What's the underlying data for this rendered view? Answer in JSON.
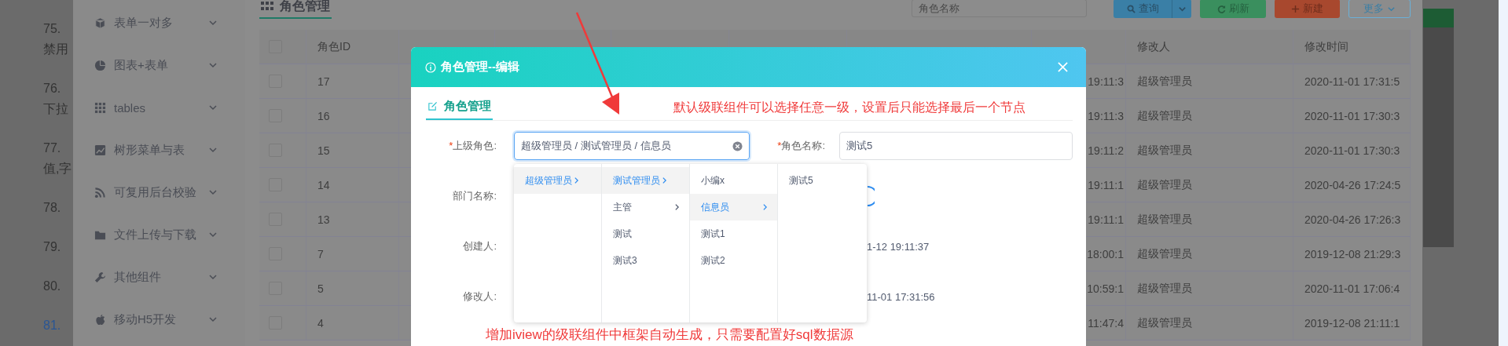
{
  "doc_items": [
    {
      "number": "75.",
      "lines": [
        "禁用"
      ],
      "active": false
    },
    {
      "number": "76.",
      "lines": [
        "下拉"
      ],
      "active": false
    },
    {
      "number": "77.",
      "lines": [
        "值,字"
      ],
      "active": false
    },
    {
      "number": "78.",
      "active": false
    },
    {
      "number": "79.",
      "active": false
    },
    {
      "number": "80.",
      "active": false
    },
    {
      "number": "81.",
      "active": true
    }
  ],
  "sidebar": {
    "items": [
      {
        "label": "表单一对多",
        "kind": "cube"
      },
      {
        "label": "图表+表单",
        "kind": "pie"
      },
      {
        "label": "tables",
        "kind": "grid"
      },
      {
        "label": "树形菜单与表",
        "kind": "chart"
      },
      {
        "label": "可复用后台校验",
        "kind": "rss"
      },
      {
        "label": "文件上传与下载",
        "kind": "folder"
      },
      {
        "label": "其他组件",
        "kind": "wrench"
      },
      {
        "label": "移动H5开发",
        "kind": "fruit"
      }
    ]
  },
  "page_title": "角色管理",
  "search": {
    "placeholder": "角色名称"
  },
  "buttons": [
    {
      "label": "查询",
      "kind": "query"
    },
    {
      "label": "刷新",
      "kind": "refresh"
    },
    {
      "label": "新建",
      "kind": "create"
    },
    {
      "label": "更多",
      "kind": "more"
    }
  ],
  "table": {
    "header_checked": false,
    "columns": [
      {
        "label": "角色ID"
      },
      {},
      {},
      {},
      {},
      {},
      {},
      {
        "label": "修改人"
      },
      {
        "label": "修改时间"
      }
    ],
    "rows": [
      {
        "checked": false,
        "id": "17",
        "column_8": "19:11:3",
        "modified_by": "超级管理员",
        "modified_time": "2020-11-01 17:31:5"
      },
      {
        "checked": false,
        "id": "16",
        "column_8": "19:11:3",
        "modified_by": "超级管理员",
        "modified_time": "2020-11-01 17:30:3"
      },
      {
        "checked": false,
        "id": "15",
        "column_8": "19:11:2",
        "modified_by": "超级管理员",
        "modified_time": "2020-11-01 17:30:3"
      },
      {
        "checked": false,
        "id": "14",
        "column_8": "19:11:1",
        "modified_by": "超级管理员",
        "modified_time": "2020-04-26 17:24:5"
      },
      {
        "checked": false,
        "id": "13",
        "column_8": "19:11:1",
        "modified_by": "超级管理员",
        "modified_time": "2020-04-26 17:26:3"
      },
      {
        "checked": false,
        "id": "7",
        "column_8": "18:00:1",
        "modified_by": "超级管理员",
        "modified_time": "2019-12-08 21:29:3"
      },
      {
        "checked": false,
        "id": "5",
        "column_8": "10:59:1",
        "modified_by": "超级管理员",
        "modified_time": "2020-11-01 17:06:4"
      },
      {
        "checked": false,
        "id": "4",
        "column_8": "11:47:4",
        "modified_by": "超级管理员",
        "modified_time": "2019-12-08 21:11:1"
      }
    ]
  },
  "modal": {
    "title": "角色管理--编辑",
    "tabs": [
      {
        "label": "角色管理",
        "selected": true
      }
    ],
    "note_top": "默认级联组件可以选择任意一级，设置后只能选择最后一个节点",
    "form_rows": [
      {
        "cells": [
          {
            "kind": "cascader",
            "required_mark": "*",
            "label": "上级角色:",
            "value": "超级管理员 / 测试管理员 / 信息员"
          },
          {
            "kind": "input",
            "required_mark": "*",
            "label": "角色名称:",
            "value": "测试5"
          }
        ]
      },
      {
        "cells": [
          {
            "kind": "label",
            "label": "部门名称:"
          },
          {
            "kind": "ring"
          }
        ]
      },
      {
        "cells": [
          {
            "kind": "label",
            "label": "创建人:"
          },
          {
            "kind": "text",
            "value": "1-12 19:11:37"
          }
        ]
      },
      {
        "cells": [
          {
            "kind": "label",
            "label": "修改人:"
          },
          {
            "kind": "text",
            "value": "11-01 17:31:56"
          }
        ]
      }
    ],
    "cascader_columns": [
      [
        {
          "label": "超级管理员",
          "has_children": true,
          "selected": true
        }
      ],
      [
        {
          "label": "测试管理员",
          "has_children": true,
          "selected": true
        },
        {
          "label": "主管",
          "has_children": true,
          "selected": false
        },
        {
          "label": "测试",
          "has_children": false,
          "selected": false
        },
        {
          "label": "测试3",
          "has_children": false,
          "selected": false
        }
      ],
      [
        {
          "label": "小编x",
          "has_children": false,
          "selected": false
        },
        {
          "label": "信息员",
          "has_children": true,
          "selected": true
        },
        {
          "label": "测试1",
          "has_children": false,
          "selected": false
        },
        {
          "label": "测试2",
          "has_children": false,
          "selected": false
        }
      ],
      [
        {
          "label": "测试5",
          "has_children": false,
          "selected": false
        }
      ]
    ],
    "note_bottom": "增加iview的级联组件中框架自动生成，只需要配置好sql数据源"
  }
}
